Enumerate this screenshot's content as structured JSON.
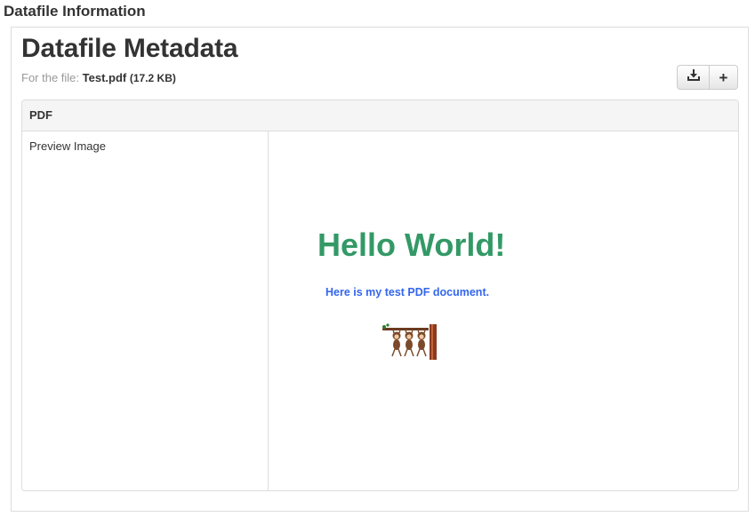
{
  "section_title": "Datafile Information",
  "header": {
    "title": "Datafile Metadata",
    "file_prefix": "For the file:",
    "file_name": "Test.pdf",
    "file_size": "(17.2 KB)"
  },
  "toolbar": {
    "download_icon": "download-icon",
    "add_label": "+"
  },
  "panel": {
    "heading": "PDF",
    "row_label": "Preview Image"
  },
  "preview": {
    "heading": "Hello World!",
    "subtext": "Here is my test PDF document.",
    "heading_color": "#339966",
    "subtext_color": "#3366ee"
  }
}
